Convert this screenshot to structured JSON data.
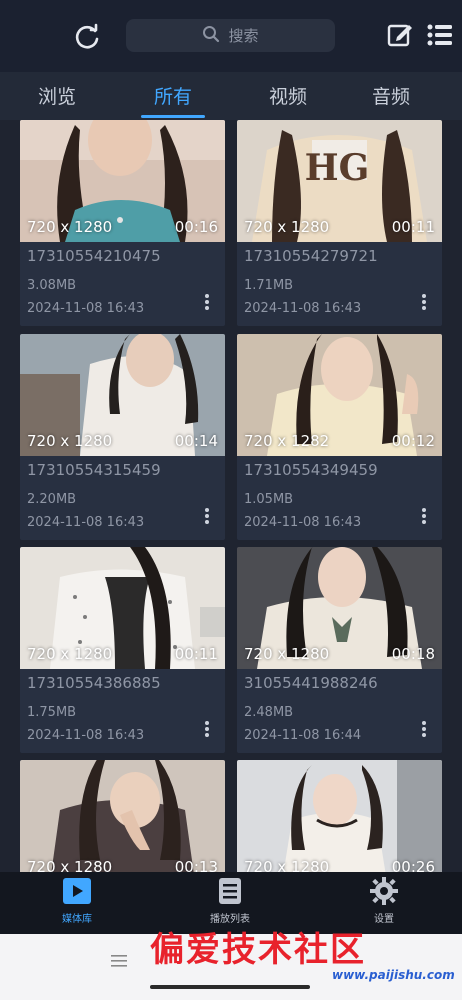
{
  "header": {
    "search_placeholder": "搜索",
    "refresh_icon": "refresh-icon",
    "edit_icon": "edit-icon",
    "list_icon": "list-icon"
  },
  "tabs": [
    {
      "label": "浏览",
      "active": false
    },
    {
      "label": "所有",
      "active": true
    },
    {
      "label": "视频",
      "active": false
    },
    {
      "label": "音频",
      "active": false
    }
  ],
  "accent_color": "#41a7ff",
  "videos": [
    {
      "resolution": "720 x 1280",
      "duration": "00:16",
      "name": "17310554210475",
      "size": "3.08MB",
      "date": "2024-11-08 16:43"
    },
    {
      "resolution": "720 x 1280",
      "duration": "00:11",
      "name": "17310554279721",
      "size": "1.71MB",
      "date": "2024-11-08 16:43"
    },
    {
      "resolution": "720 x 1280",
      "duration": "00:14",
      "name": "17310554315459",
      "size": "2.20MB",
      "date": "2024-11-08 16:43"
    },
    {
      "resolution": "720 x 1282",
      "duration": "00:12",
      "name": "17310554349459",
      "size": "1.05MB",
      "date": "2024-11-08 16:43"
    },
    {
      "resolution": "720 x 1280",
      "duration": "00:11",
      "name": "17310554386885",
      "size": "1.75MB",
      "date": "2024-11-08 16:43"
    },
    {
      "resolution": "720 x 1280",
      "duration": "00:18",
      "name": "31055441988246",
      "size": "2.48MB",
      "date": "2024-11-08 16:44"
    },
    {
      "resolution": "720 x 1280",
      "duration": "00:13",
      "name": "",
      "size": "",
      "date": ""
    },
    {
      "resolution": "720 x 1280",
      "duration": "00:26",
      "name": "",
      "size": "",
      "date": ""
    }
  ],
  "bottom_nav": [
    {
      "label": "媒体库",
      "icon": "media-library-icon",
      "active": true
    },
    {
      "label": "播放列表",
      "icon": "playlist-icon",
      "active": false
    },
    {
      "label": "设置",
      "icon": "settings-icon",
      "active": false
    }
  ],
  "watermark": {
    "text": "偏爱技术社区",
    "url": "www.paijishu.com"
  }
}
